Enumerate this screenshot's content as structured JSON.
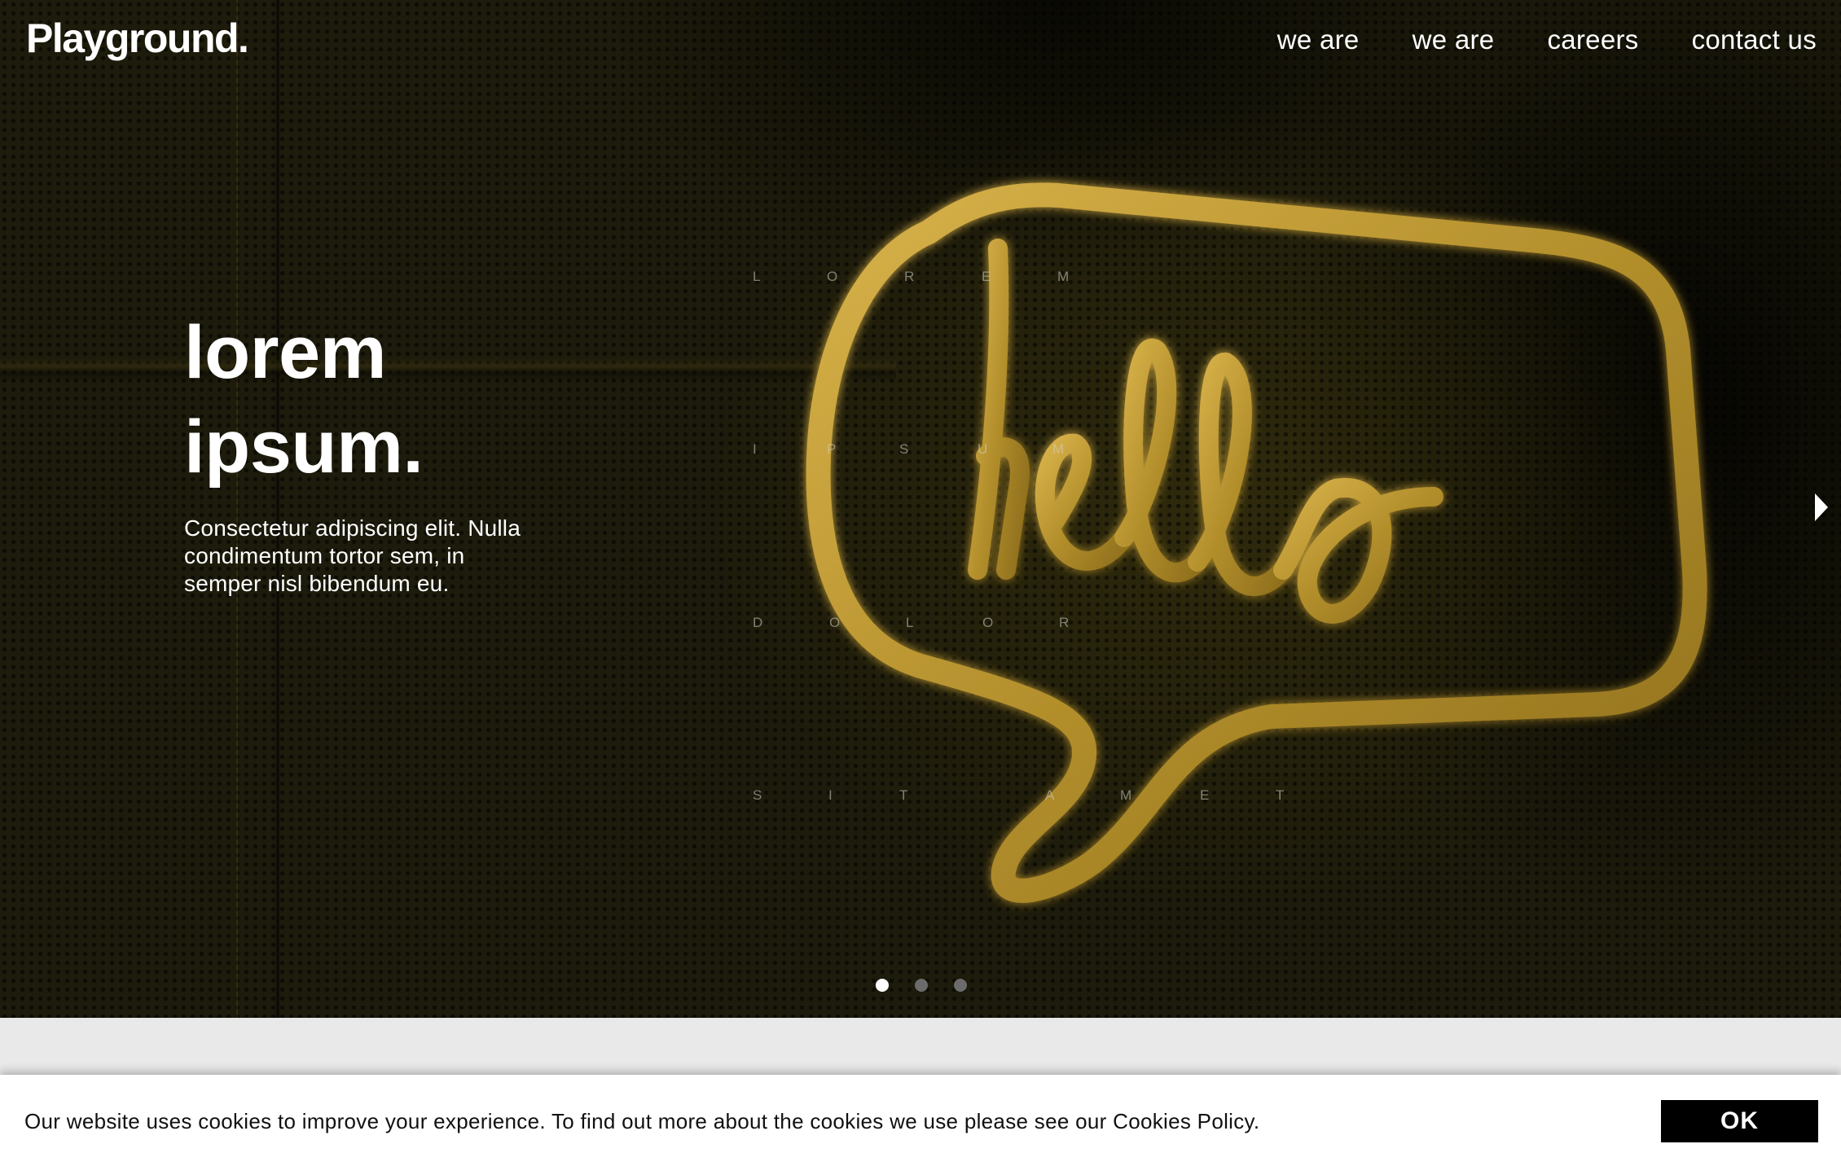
{
  "brand": {
    "logo": "Playground."
  },
  "nav": {
    "items": [
      "we are",
      "we are",
      "careers",
      "contact us"
    ]
  },
  "hero": {
    "headline": [
      "lorem",
      "ipsum."
    ],
    "subtext": "Consectetur adipiscing elit. Nulla condimentum tortor sem, in semper nisl bibendum eu.",
    "neon_word": "hello",
    "scattered_letters": {
      "row1": [
        "L",
        "O",
        "R",
        "E",
        "M"
      ],
      "row2": [
        "I",
        "P",
        "S",
        "U",
        "M"
      ],
      "row3": [
        "D",
        "O",
        "L",
        "O",
        "R"
      ],
      "row4": [
        "S",
        "I",
        "T",
        "A",
        "M",
        "E",
        "T"
      ]
    },
    "carousel": {
      "slide_count": 3,
      "active_index": 0,
      "next_icon": "chevron-right-icon"
    }
  },
  "cookie_banner": {
    "message": "Our website uses cookies to improve your experience. To find out more about the cookies we use please see our Cookies Policy.",
    "ok_label": "OK"
  },
  "colors": {
    "hero_bg": "#1d1b0b",
    "neon": "#c9a43a",
    "text_light": "#ffffff",
    "cookie_bg": "#ffffff",
    "button_bg": "#000000"
  }
}
